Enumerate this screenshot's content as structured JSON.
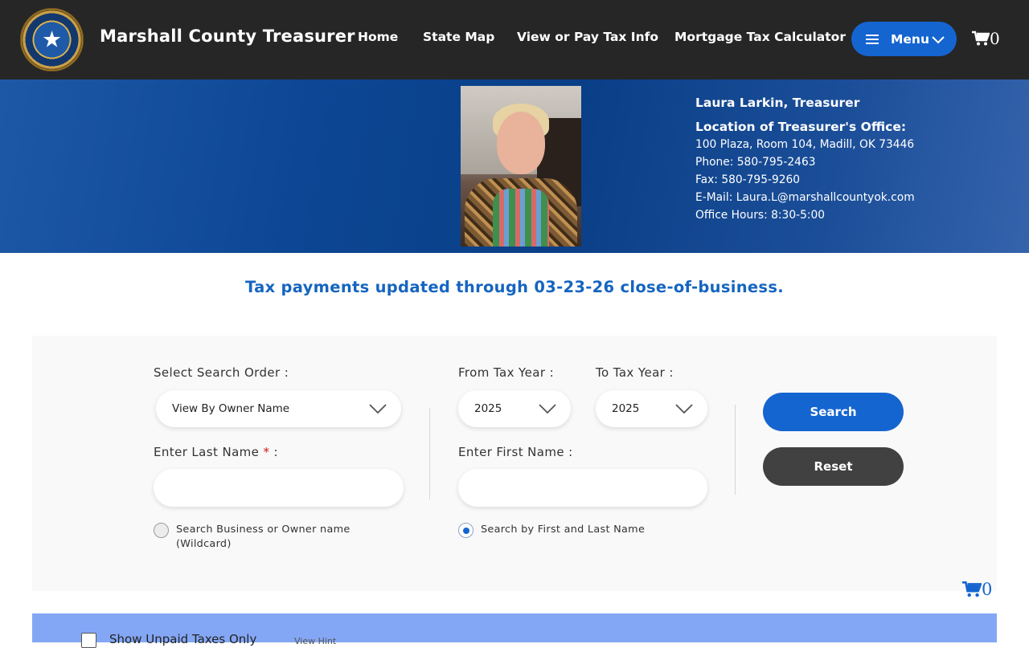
{
  "header": {
    "site_title": "Marshall County Treasurer",
    "nav": [
      "Home",
      "State Map",
      "View or Pay Tax Info",
      "Mortgage Tax Calculator"
    ],
    "menu_label": "Menu",
    "cart_count": "0"
  },
  "treasurer": {
    "name": "Laura Larkin, Treasurer",
    "location_title": "Location of Treasurer's Office:",
    "address": "100 Plaza, Room 104, Madill, OK 73446",
    "phone": "Phone: 580-795-2463",
    "fax": "Fax: 580-795-9260",
    "email": "E-Mail: Laura.L@marshallcountyok.com",
    "hours": "Office Hours: 8:30-5:00"
  },
  "notice": "Tax payments updated through 03-23-26 close-of-business.",
  "search": {
    "order_label": "Select Search Order :",
    "order_value": "View By Owner Name",
    "from_year_label": "From Tax Year :",
    "from_year_value": "2025",
    "to_year_label": "To Tax Year :",
    "to_year_value": "2025",
    "last_name_label": "Enter Last Name",
    "required_mark": "*",
    "label_colon": " :",
    "first_name_label": "Enter First Name :",
    "last_name_value": "",
    "first_name_value": "",
    "radio_wildcard_line1": "Search Business or Owner name",
    "radio_wildcard_line2": "(Wildcard)",
    "radio_first_last": "Search by First and Last Name",
    "selected_radio": "first_last",
    "search_button": "Search",
    "reset_button": "Reset"
  },
  "cart_secondary_count": "0",
  "filters": {
    "unpaid_only_label": "Show Unpaid Taxes Only",
    "unpaid_only_checked": false,
    "hint_link": "View Hint"
  },
  "colors": {
    "topbar": "#262626",
    "accent_blue": "#1565d0",
    "reset_gray": "#414141",
    "filter_bar": "#84a7f5"
  },
  "icons": [
    "state-seal-logo",
    "hamburger-icon",
    "chevron-down-icon",
    "cart-icon"
  ]
}
